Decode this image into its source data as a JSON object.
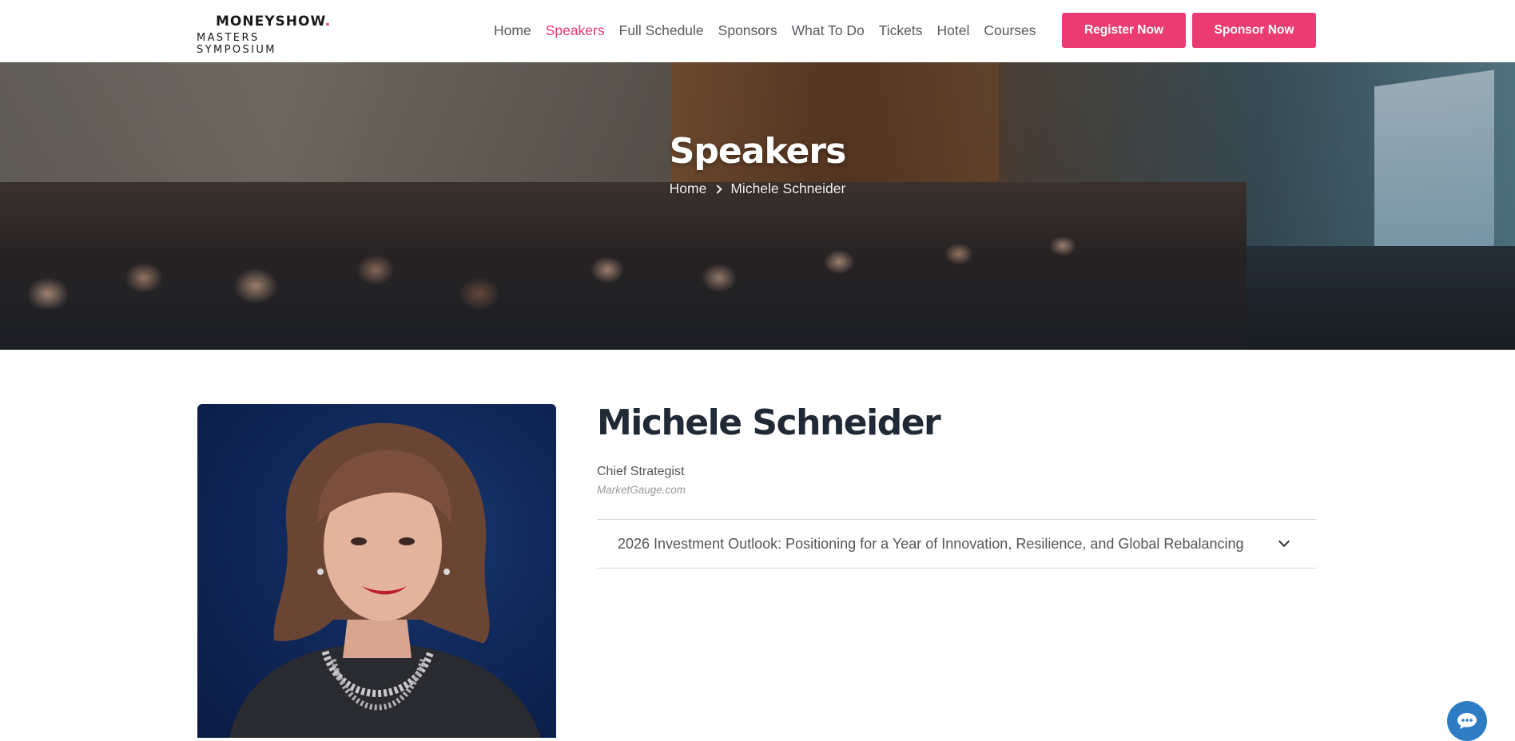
{
  "header": {
    "logo_top": "MONEYSHOW",
    "logo_dot": ".",
    "logo_bottom": "MASTERS SYMPOSIUM",
    "nav": [
      {
        "label": "Home",
        "active": false
      },
      {
        "label": "Speakers",
        "active": true
      },
      {
        "label": "Full Schedule",
        "active": false
      },
      {
        "label": "Sponsors",
        "active": false
      },
      {
        "label": "What To Do",
        "active": false
      },
      {
        "label": "Tickets",
        "active": false
      },
      {
        "label": "Hotel",
        "active": false
      },
      {
        "label": "Courses",
        "active": false
      }
    ],
    "register_label": "Register Now",
    "sponsor_label": "Sponsor Now"
  },
  "hero": {
    "title": "Speakers",
    "breadcrumb_home": "Home",
    "breadcrumb_current": "Michele Schneider"
  },
  "speaker": {
    "name": "Michele Schneider",
    "title": "Chief Strategist",
    "company": "MarketGauge.com",
    "sessions": [
      {
        "label": "2026 Investment Outlook: Positioning for a Year of Innovation, Resilience, and Global Rebalancing"
      }
    ]
  },
  "colors": {
    "accent": "#e8396f",
    "heading": "#1f2a36",
    "chat": "#2e7cc4"
  },
  "icons": {
    "breadcrumb_separator": "chevron-right-icon",
    "accordion_toggle": "chevron-down-icon",
    "chat": "chat-icon"
  }
}
